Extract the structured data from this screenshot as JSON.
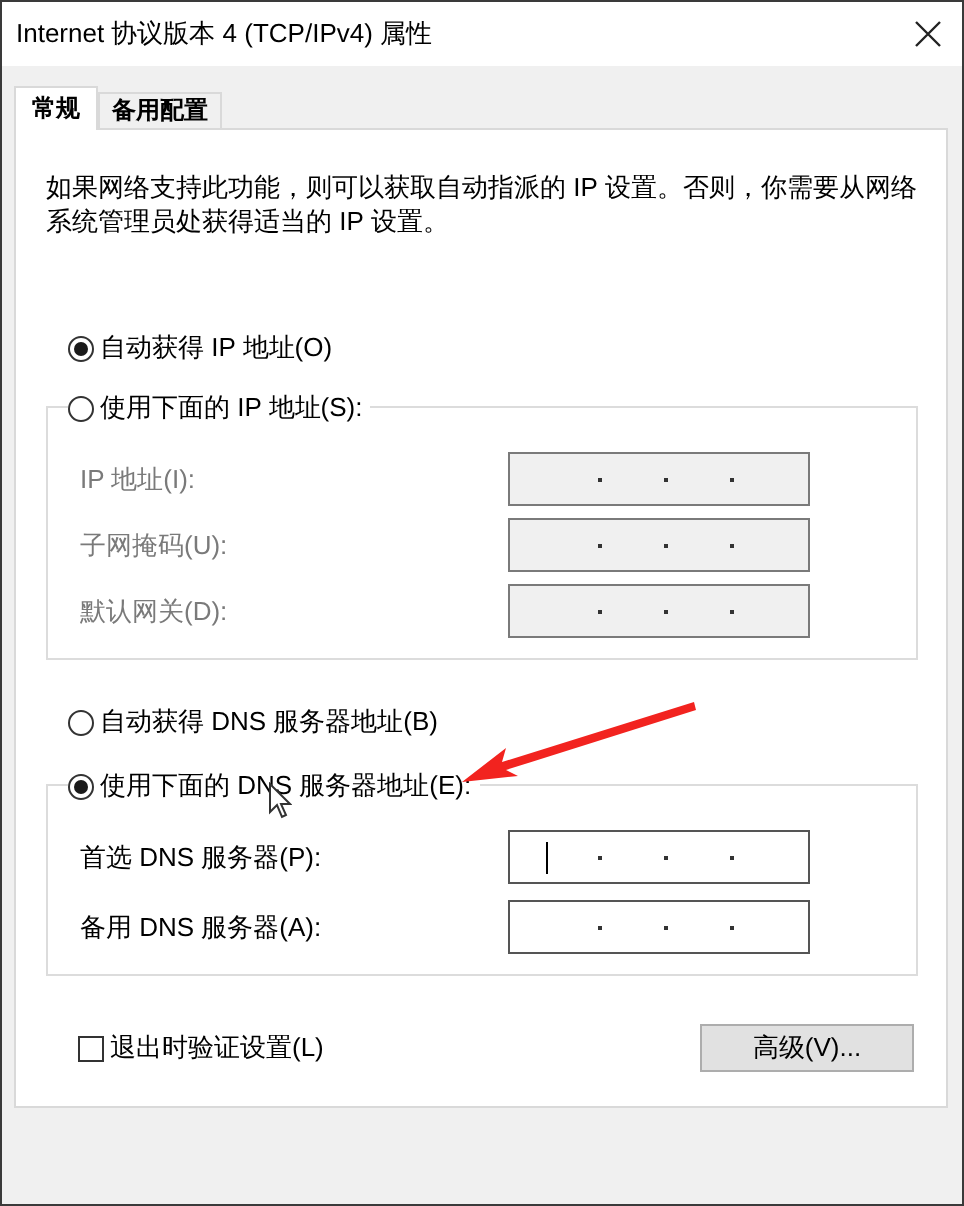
{
  "window": {
    "title": "Internet 协议版本 4 (TCP/IPv4) 属性"
  },
  "tabs": [
    {
      "label": "常规",
      "selected": true
    },
    {
      "label": "备用配置",
      "selected": false
    }
  ],
  "description": "如果网络支持此功能，则可以获取自动指派的 IP 设置。否则，你需要从网络系统管理员处获得适当的 IP 设置。",
  "ip_auto_option": {
    "label": "自动获得 IP 地址(O)",
    "selected": true
  },
  "ip_manual_group": {
    "option": {
      "label": "使用下面的 IP 地址(S):",
      "selected": false
    },
    "fields": [
      {
        "label": "IP 地址(I):",
        "disabled": true,
        "focused": false
      },
      {
        "label": "子网掩码(U):",
        "disabled": true,
        "focused": false
      },
      {
        "label": "默认网关(D):",
        "disabled": true,
        "focused": false
      }
    ]
  },
  "dns_auto_option": {
    "label": "自动获得 DNS 服务器地址(B)",
    "selected": false
  },
  "dns_manual_group": {
    "option": {
      "label": "使用下面的 DNS 服务器地址(E):",
      "selected": true
    },
    "fields": [
      {
        "label": "首选 DNS 服务器(P):",
        "disabled": false,
        "focused": true
      },
      {
        "label": "备用 DNS 服务器(A):",
        "disabled": false,
        "focused": false
      }
    ]
  },
  "validate_checkbox": {
    "label": "退出时验证设置(L)",
    "checked": false
  },
  "advanced_button": "高级(V)..."
}
